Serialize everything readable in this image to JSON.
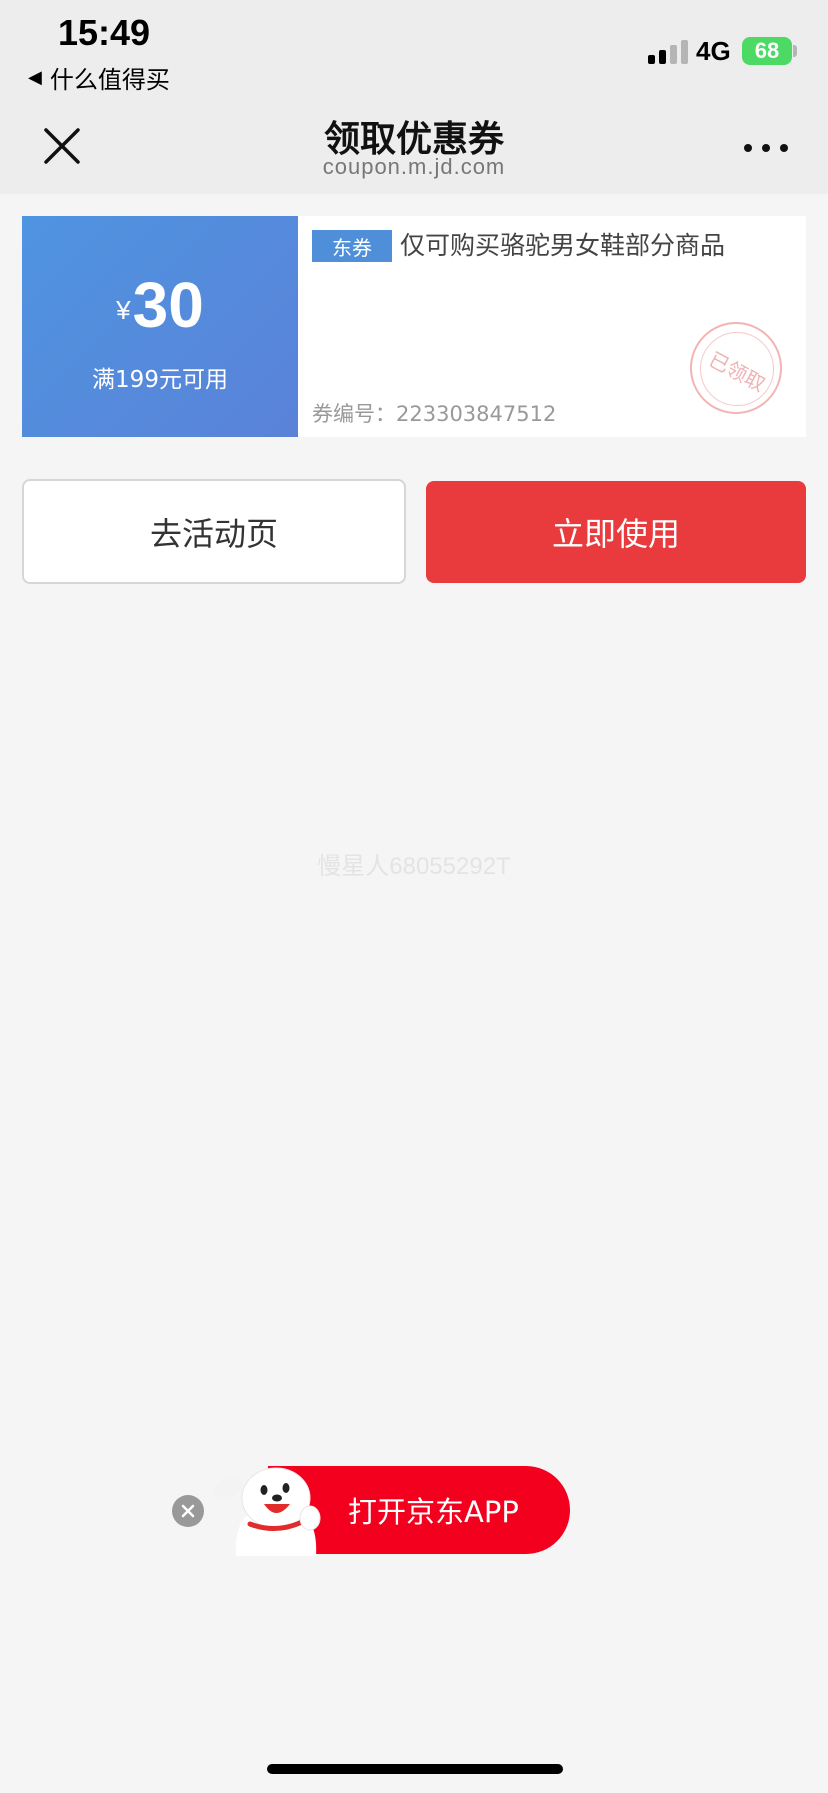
{
  "status_bar": {
    "time": "15:49",
    "back_app": "什么值得买",
    "network": "4G",
    "battery": "68"
  },
  "nav": {
    "title": "领取优惠券",
    "url": "coupon.m.jd.com"
  },
  "coupon": {
    "currency": "¥",
    "amount": "30",
    "condition": "满199元可用",
    "tag": "东券",
    "description": "仅可购买骆驼男女鞋部分商品",
    "number_label": "券编号：",
    "number": "223303847512",
    "stamp": "已领取"
  },
  "actions": {
    "activity_label": "去活动页",
    "use_label": "立即使用"
  },
  "watermark": "慢星人68055292T",
  "banner": {
    "open_app_label": "打开京东APP"
  },
  "colors": {
    "accent_red": "#e93b3d",
    "coupon_blue": "#4f94e0",
    "battery_green": "#4cd964"
  }
}
